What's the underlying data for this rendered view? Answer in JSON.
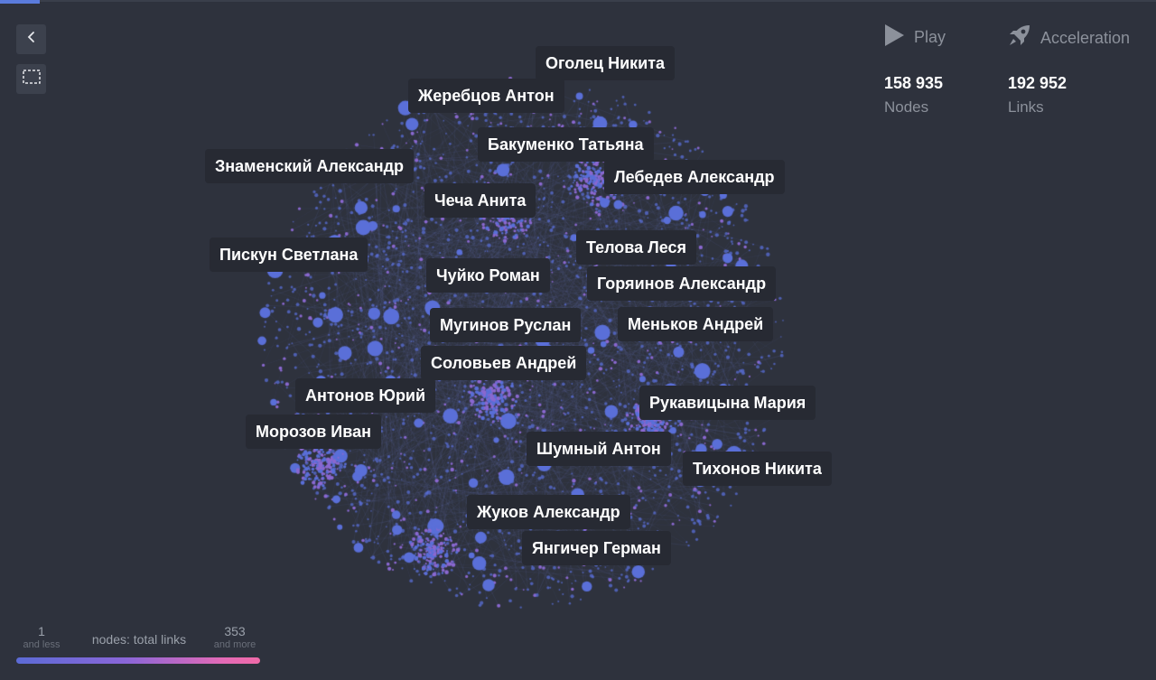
{
  "toolbar": {
    "back_icon": "chevron-left-icon",
    "select_icon": "dashed-selection-icon"
  },
  "controls": {
    "play_label": "Play",
    "acceleration_label": "Acceleration"
  },
  "stats": {
    "nodes_value": "158 935",
    "nodes_label": "Nodes",
    "links_value": "192 952",
    "links_label": "Links"
  },
  "legend": {
    "min_value": "1",
    "min_sub": "and less",
    "caption": "nodes: total links",
    "max_value": "353",
    "max_sub": "and more"
  },
  "colors": {
    "background": "#2e323d",
    "node": "#5a6fd8",
    "node_dense": "#8a68d0",
    "edge": "#6f7fd0",
    "label_bg": "#272a33",
    "gradient_start": "#5c6bd6",
    "gradient_end": "#ef6aa8"
  },
  "labels": [
    "Оголец Никита",
    "Жеребцов Антон",
    "Бакуменко Татьяна",
    "Знаменский Александр",
    "Лебедев Александр",
    "Чеча Анита",
    "Телова Леся",
    "Пискун Светлана",
    "Чуйко Роман",
    "Горяинов Александр",
    "Мугинов Руслан",
    "Меньков Андрей",
    "Соловьев Андрей",
    "Антонов Юрий",
    "Рукавицына Мария",
    "Морозов Иван",
    "Шумный Антон",
    "Тихонов Никита",
    "Жуков Александр",
    "Янгичер Герман"
  ]
}
